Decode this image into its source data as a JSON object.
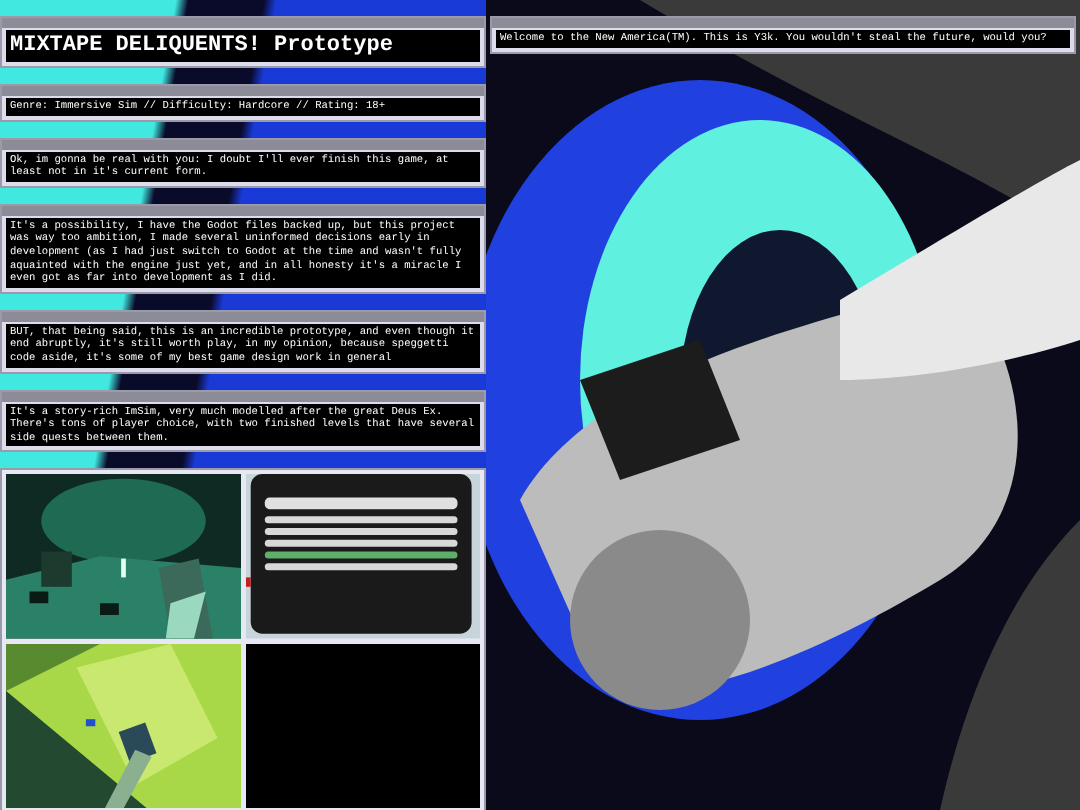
{
  "title": "MIXTAPE DELIQUENTS! Prototype",
  "info": "Genre: Immersive Sim // Difficulty: Hardcore // Rating: 18+",
  "paragraphs": [
    "Ok, im gonna be real with you: I doubt I'll ever finish this game, at least not in it's current form.",
    "It's a possibility, I have the Godot files backed up, but this project was way too ambition, I made several uninformed decisions early in development (as I had just switch to Godot at the time and wasn't fully aquainted with the engine just yet, and in all honesty it's a miracle I even got as far into development as I did.",
    "BUT, that being said, this is an incredible prototype, and even though it end abruptly, it's still worth play, in my opinion, because speggetti code aside, it's some of my best game design work in general",
    "It's a story-rich ImSim, very much modelled after the great Deus Ex. There's tons of player choice, with two finished levels that have several side quests between them."
  ],
  "banner": "Welcome to the New America(TM). This is Y3k. You wouldn't steal the future, would you?",
  "gallery": [
    {
      "kind": "picture"
    },
    {
      "kind": "picture"
    },
    {
      "kind": "picture"
    },
    {
      "kind": "empty"
    }
  ]
}
